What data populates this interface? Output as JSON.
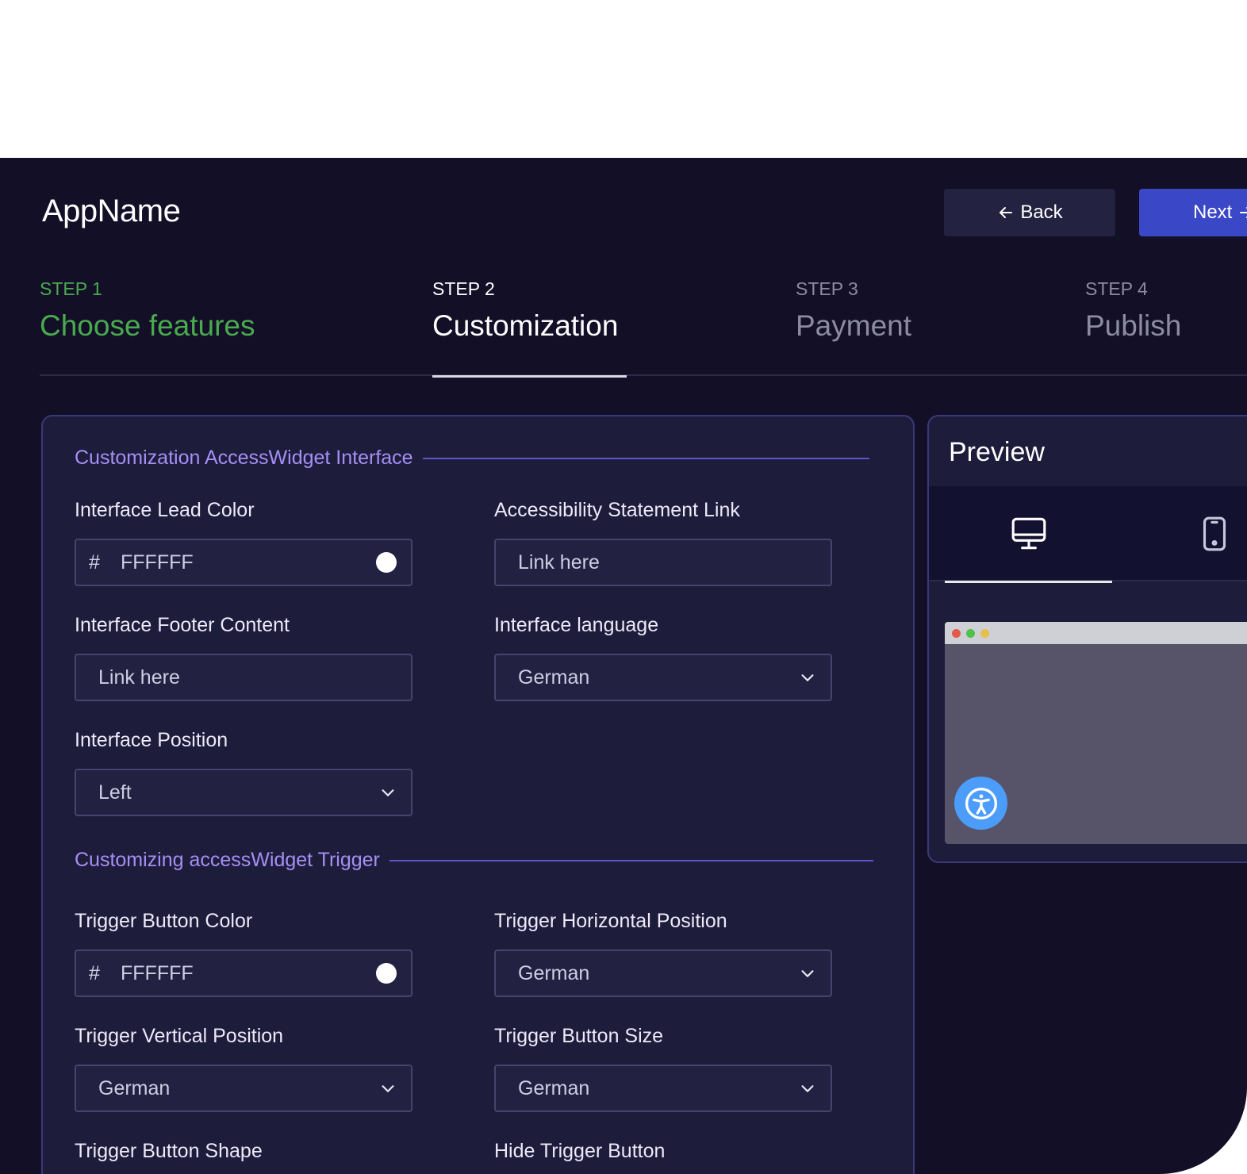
{
  "app": {
    "name": "AppName"
  },
  "nav": {
    "back_label": "Back",
    "next_label": "Next"
  },
  "steps": [
    {
      "number": "STEP 1",
      "title": "Choose features",
      "state": "done"
    },
    {
      "number": "STEP 2",
      "title": "Customization",
      "state": "active"
    },
    {
      "number": "STEP 3",
      "title": "Payment",
      "state": "todo"
    },
    {
      "number": "STEP 4",
      "title": "Publish",
      "state": "todo"
    }
  ],
  "interface_section": {
    "title": "Customization AccessWidget Interface",
    "lead_color": {
      "label": "Interface Lead Color",
      "hash": "#",
      "value": "FFFFFF",
      "swatch": "#FFFFFF"
    },
    "statement_link": {
      "label": "Accessibility Statement Link",
      "placeholder": "Link here"
    },
    "footer_content": {
      "label": "Interface Footer Content",
      "placeholder": "Link here"
    },
    "language": {
      "label": "Interface language",
      "value": "German"
    },
    "position": {
      "label": "Interface Position",
      "value": "Left"
    }
  },
  "trigger_section": {
    "title": "Customizing accessWidget Trigger",
    "button_color": {
      "label": "Trigger Button Color",
      "hash": "#",
      "value": "FFFFFF",
      "swatch": "#FFFFFF"
    },
    "horizontal_position": {
      "label": "Trigger Horizontal Position",
      "value": "German"
    },
    "vertical_position": {
      "label": "Trigger Vertical Position",
      "value": "German"
    },
    "button_size": {
      "label": "Trigger Button Size",
      "value": "German"
    },
    "button_shape": {
      "label": "Trigger Button Shape"
    },
    "hide_button": {
      "label": "Hide Trigger Button"
    }
  },
  "preview": {
    "title": "Preview",
    "tabs": [
      {
        "icon": "desktop-icon",
        "active": true
      },
      {
        "icon": "mobile-icon",
        "active": false
      }
    ],
    "browser_dots": [
      "#e25b4a",
      "#4fc04a",
      "#e6c04a"
    ],
    "widget_color": "#4c9dfa",
    "widget_icon": "accessibility-icon"
  }
}
